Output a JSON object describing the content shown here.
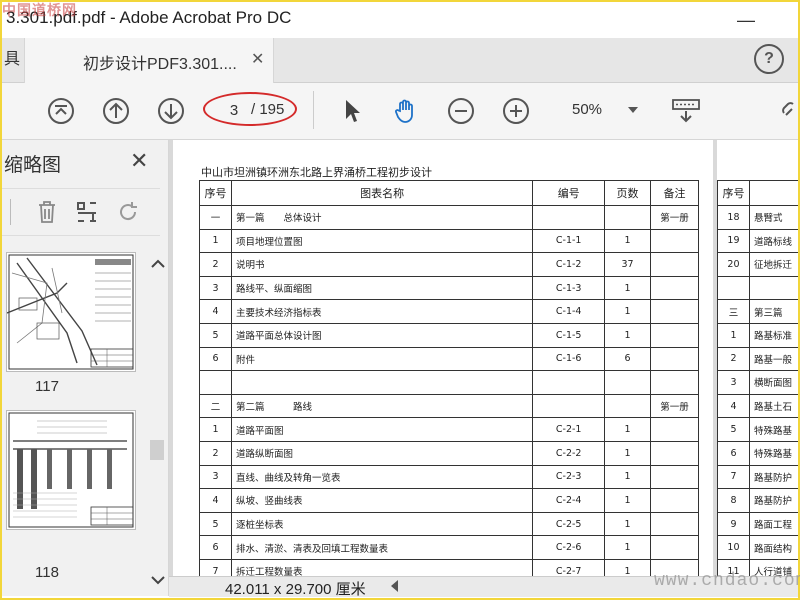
{
  "window": {
    "title": "3.301.pdf.pdf - Adobe Acrobat Pro DC",
    "watermark_top": "中国道桥网"
  },
  "tabs": {
    "tools_stub": "具",
    "document_tab": "初步设计PDF3.301....",
    "help_label": "?"
  },
  "toolbar": {
    "current_page": "3",
    "page_total": "/ 195",
    "zoom_value": "50%"
  },
  "thumbnails_panel": {
    "title": "缩略图",
    "items": [
      {
        "page_number": "117"
      },
      {
        "page_number": "118"
      }
    ]
  },
  "document": {
    "heading": "中山市坦洲镇环洲东北路上界涌桥工程初步设计",
    "columns": [
      "序号",
      "图表名称",
      "编号",
      "页数",
      "备注"
    ],
    "rows": [
      [
        "一",
        "第一篇　　总体设计",
        "",
        "",
        "第一册"
      ],
      [
        "1",
        "项目地理位置图",
        "C-1-1",
        "1",
        ""
      ],
      [
        "2",
        "说明书",
        "C-1-2",
        "37",
        ""
      ],
      [
        "3",
        "路线平、纵面缩图",
        "C-1-3",
        "1",
        ""
      ],
      [
        "4",
        "主要技术经济指标表",
        "C-1-4",
        "1",
        ""
      ],
      [
        "5",
        "道路平面总体设计图",
        "C-1-5",
        "1",
        ""
      ],
      [
        "6",
        "附件",
        "C-1-6",
        "6",
        ""
      ],
      [
        "",
        "",
        "",
        "",
        ""
      ],
      [
        "二",
        "第二篇　　　路线",
        "",
        "",
        "第一册"
      ],
      [
        "1",
        "道路平面图",
        "C-2-1",
        "1",
        ""
      ],
      [
        "2",
        "道路纵断面图",
        "C-2-2",
        "1",
        ""
      ],
      [
        "3",
        "直线、曲线及转角一览表",
        "C-2-3",
        "1",
        ""
      ],
      [
        "4",
        "纵坡、竖曲线表",
        "C-2-4",
        "1",
        ""
      ],
      [
        "5",
        "逐桩坐标表",
        "C-2-5",
        "1",
        ""
      ],
      [
        "6",
        "排水、清淤、清表及回填工程数量表",
        "C-2-6",
        "1",
        ""
      ],
      [
        "7",
        "拆迁工程数量表",
        "C-2-7",
        "1",
        ""
      ]
    ],
    "page2_header": "序号",
    "page2_rows": [
      [
        "18",
        "悬臂式"
      ],
      [
        "19",
        "道路标线"
      ],
      [
        "20",
        "征地拆迁"
      ],
      [
        "",
        ""
      ],
      [
        "三",
        "第三篇"
      ],
      [
        "1",
        "路基标准"
      ],
      [
        "2",
        "路基一般"
      ],
      [
        "3",
        "横断面图"
      ],
      [
        "4",
        "路基土石"
      ],
      [
        "5",
        "特殊路基"
      ],
      [
        "6",
        "特殊路基"
      ],
      [
        "7",
        "路基防护"
      ],
      [
        "8",
        "路基防护"
      ],
      [
        "9",
        "路面工程"
      ],
      [
        "10",
        "路面结构"
      ],
      [
        "11",
        "人行道铺"
      ]
    ]
  },
  "status": {
    "page_dimensions": "42.011 x 29.700 厘米"
  },
  "watermark_bottom": "www.cndao.com",
  "colors": {
    "annotation_ring": "#d42a2a",
    "hand_tool_active": "#1e72c8",
    "frame_border": "#f2d63a"
  }
}
